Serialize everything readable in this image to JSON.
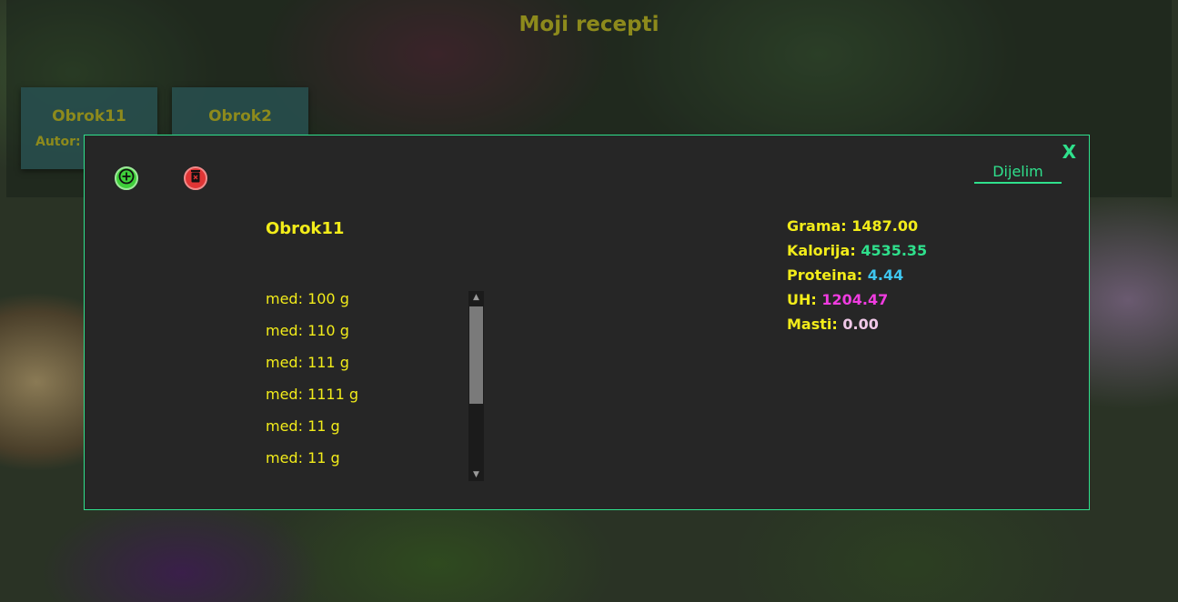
{
  "header": {
    "title": "Moji recepti"
  },
  "recipe_cards": [
    {
      "name": "Obrok11",
      "author_label": "Autor:"
    },
    {
      "name": "Obrok2"
    }
  ],
  "modal": {
    "close_label": "X",
    "add_icon": "plus-circle-icon",
    "delete_icon": "trash-icon",
    "share_label": "Dijelim",
    "meal_name": "Obrok11",
    "ingredients": [
      "med: 100 g",
      "med: 110 g",
      "med: 111 g",
      "med: 1111 g",
      "med: 11 g",
      "med: 11 g"
    ],
    "stats": {
      "grams": {
        "label": "Grama:",
        "value": "1487.00",
        "color": "#f2ec1a"
      },
      "calories": {
        "label": "Kalorija:",
        "value": "4535.35",
        "color": "#2fe08c"
      },
      "protein": {
        "label": "Proteina:",
        "value": "4.44",
        "color": "#3ec6f0"
      },
      "carbs": {
        "label": "UH:",
        "value": "1204.47",
        "color": "#f03ce0"
      },
      "fat": {
        "label": "Masti:",
        "value": "0.00",
        "color": "#f0c8e8"
      }
    }
  },
  "colors": {
    "accent": "#2fe08c",
    "text_yellow": "#f2ec1a",
    "title_olive": "#8d8a1c"
  }
}
